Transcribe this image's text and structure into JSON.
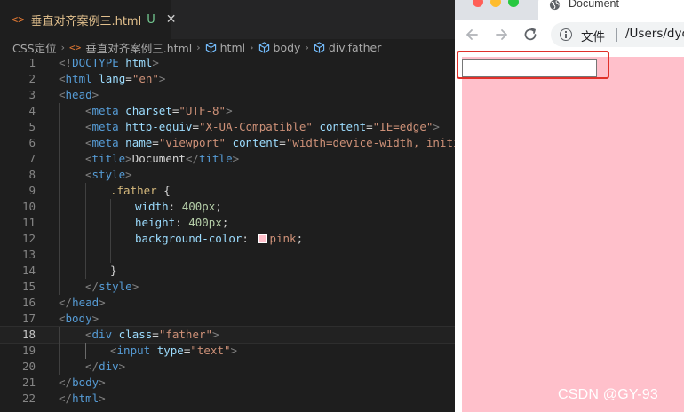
{
  "editor": {
    "tab": {
      "icon": "html-file-icon",
      "filename": "垂直对齐案例三.html",
      "git_status": "U",
      "close_glyph": "✕"
    },
    "breadcrumb": {
      "folder": "CSS定位",
      "file": "垂直对齐案例三.html",
      "symbols": [
        "html",
        "body",
        "div.father"
      ]
    },
    "current_line": 18,
    "colors": {
      "background": "#1e1e1e",
      "tag": "#569cd6",
      "attribute": "#9cdcfe",
      "string": "#ce9178",
      "number": "#b5cea8",
      "selector": "#d7ba7d"
    }
  },
  "code": {
    "l1": {
      "open": "<!",
      "tag": "DOCTYPE",
      "attr": "html",
      "close": ">"
    },
    "l2": {
      "open": "<",
      "tag": "html",
      "attr": "lang",
      "eq": "=",
      "val": "\"en\"",
      "close": ">"
    },
    "l3": {
      "open": "<",
      "tag": "head",
      "close": ">"
    },
    "l4": {
      "open": "<",
      "tag": "meta",
      "attr": "charset",
      "eq": "=",
      "val": "\"UTF-8\"",
      "close": ">"
    },
    "l5": {
      "open": "<",
      "tag": "meta",
      "attr": "http-equiv",
      "eq": "=",
      "val": "\"X-UA-Compatible\"",
      "attr2": "content",
      "val2": "\"IE=edge\"",
      "close": ">"
    },
    "l6": {
      "open": "<",
      "tag": "meta",
      "attr": "name",
      "eq": "=",
      "val": "\"viewport\"",
      "attr2": "content",
      "val2": "\"width=device-width, initial"
    },
    "l7": {
      "open": "<",
      "tag": "title",
      "close": ">",
      "text": "Document",
      "endopen": "</",
      "endtag": "title"
    },
    "l8": {
      "open": "<",
      "tag": "style",
      "close": ">"
    },
    "l9": {
      "selector": ".father",
      "brace": " {"
    },
    "l10": {
      "prop": "width",
      "colon": ": ",
      "value": "400px",
      "semi": ";"
    },
    "l11": {
      "prop": "height",
      "colon": ": ",
      "value": "400px",
      "semi": ";"
    },
    "l12": {
      "prop": "background-color",
      "colon": ": ",
      "value": "pink",
      "semi": ";",
      "swatch_color": "#ffc0cb"
    },
    "l13": {},
    "l14": {
      "brace": "}"
    },
    "l15": {
      "open": "</",
      "tag": "style",
      "close": ">"
    },
    "l16": {
      "open": "</",
      "tag": "head",
      "close": ">"
    },
    "l17": {
      "open": "<",
      "tag": "body",
      "close": ">"
    },
    "l18": {
      "open": "<",
      "tag": "div",
      "attr": "class",
      "eq": "=",
      "val": "\"father\"",
      "close": ">"
    },
    "l19": {
      "open": "<",
      "tag": "input",
      "attr": "type",
      "eq": "=",
      "val": "\"text\"",
      "close": ">"
    },
    "l20": {
      "open": "</",
      "tag": "div",
      "close": ">"
    },
    "l21": {
      "open": "</",
      "tag": "body",
      "close": ">"
    },
    "l22": {
      "open": "</",
      "tag": "html",
      "close": ">"
    }
  },
  "browser": {
    "tab_title": "Document",
    "address_scheme": "文件",
    "address_path": "/Users/dyc/",
    "page": {
      "father_background": "pink",
      "input_value": "",
      "highlight_color": "#e0312a"
    }
  },
  "watermark": "CSDN @GY-93"
}
